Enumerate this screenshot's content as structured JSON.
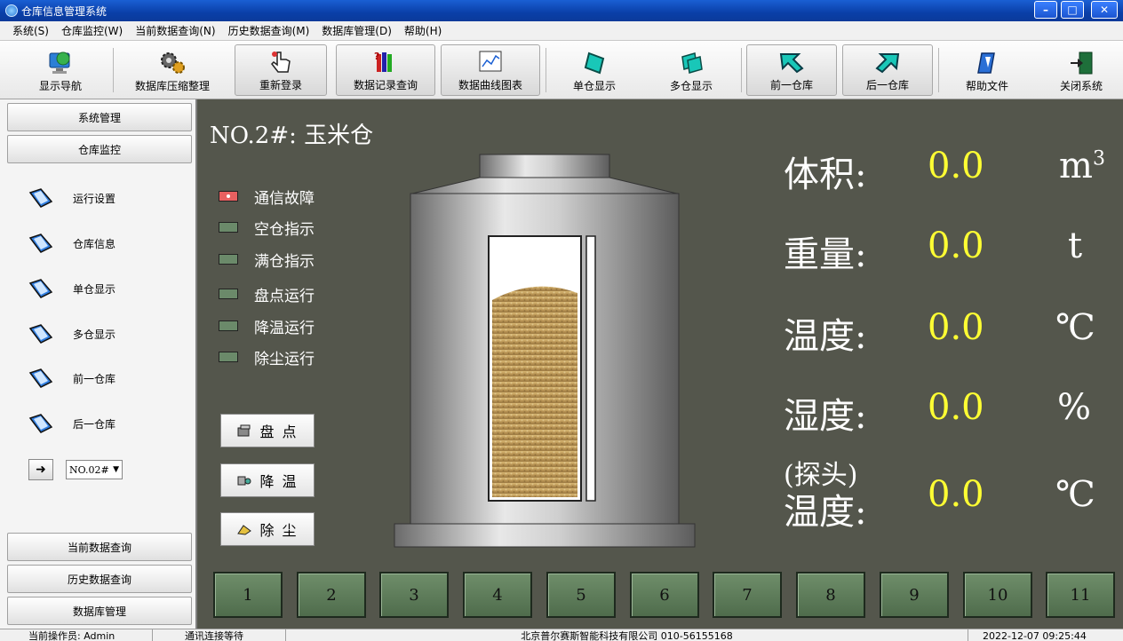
{
  "window": {
    "title": "仓库信息管理系统"
  },
  "menu": [
    "系统(S)",
    "仓库监控(W)",
    "当前数据查询(N)",
    "历史数据查询(M)",
    "数据库管理(D)",
    "帮助(H)"
  ],
  "toolbar": [
    {
      "label": "显示导航",
      "icon": "monitor-globe-icon"
    },
    {
      "label": "数据库压缩整理",
      "icon": "gears-icon"
    },
    {
      "label": "重新登录",
      "icon": "hand-cursor-icon"
    },
    {
      "label": "数据记录查询",
      "icon": "books-icon"
    },
    {
      "label": "数据曲线图表",
      "icon": "chart-icon"
    },
    {
      "label": "单仓显示",
      "icon": "single-bin-icon"
    },
    {
      "label": "多仓显示",
      "icon": "multi-bin-icon"
    },
    {
      "label": "前一仓库",
      "icon": "prev-arrow-icon"
    },
    {
      "label": "后一仓库",
      "icon": "next-arrow-icon"
    },
    {
      "label": "帮助文件",
      "icon": "help-book-icon"
    },
    {
      "label": "关闭系统",
      "icon": "exit-door-icon"
    }
  ],
  "sidebar": {
    "top": [
      "系统管理",
      "仓库监控"
    ],
    "items": [
      "运行设置",
      "仓库信息",
      "单仓显示",
      "多仓显示",
      "前一仓库",
      "后一仓库"
    ],
    "select_value": "NO.02#",
    "bottom": [
      "当前数据查询",
      "历史数据查询",
      "数据库管理"
    ]
  },
  "main": {
    "title": "NO.2#: 玉米仓",
    "indicators": [
      {
        "label": "通信故障",
        "state": "fault"
      },
      {
        "label": "空仓指示",
        "state": "off"
      },
      {
        "label": "满仓指示",
        "state": "off"
      },
      {
        "label": "盘点运行",
        "state": "off"
      },
      {
        "label": "降温运行",
        "state": "off"
      },
      {
        "label": "除尘运行",
        "state": "off"
      }
    ],
    "actions": [
      "盘 点",
      "降 温",
      "除 尘"
    ],
    "metrics": [
      {
        "label": "体积:",
        "value": "0.0",
        "unit": "m",
        "sup": "3"
      },
      {
        "label": "重量:",
        "value": "0.0",
        "unit": "t"
      },
      {
        "label": "温度:",
        "value": "0.0",
        "unit": "℃"
      },
      {
        "label": "湿度:",
        "value": "0.0",
        "unit": "%"
      },
      {
        "label_line1": "(探头)",
        "label_line2": "温度:",
        "value": "0.0",
        "unit": "℃"
      }
    ],
    "bins": [
      "1",
      "2",
      "3",
      "4",
      "5",
      "6",
      "7",
      "8",
      "9",
      "10",
      "11"
    ]
  },
  "status": {
    "operator": "当前操作员: Admin",
    "comm": "通讯连接等待",
    "company": "北京普尔赛斯智能科技有限公司 010-56155168",
    "datetime": "2022-12-07 09:25:44"
  },
  "colors": {
    "panel": "#54564c",
    "value": "#ffff33",
    "led_off": "#6b8a6a",
    "led_fault": "#e86060",
    "bin_button": "#5f7e5b"
  }
}
